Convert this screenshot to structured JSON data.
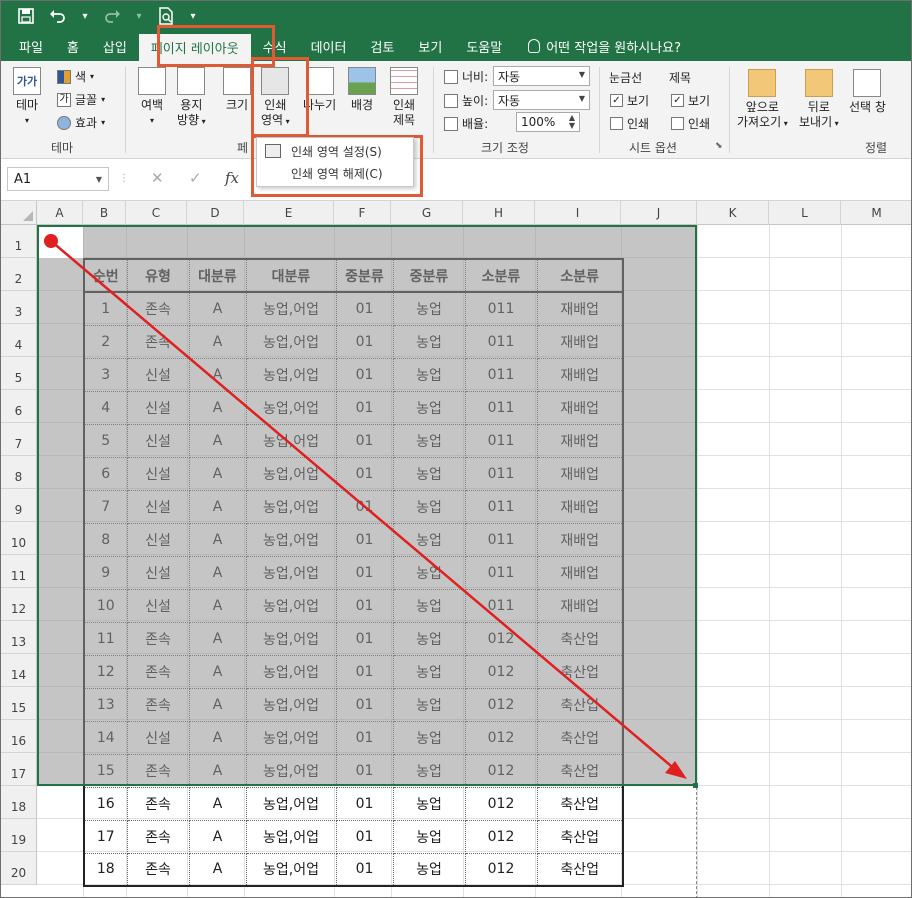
{
  "quick_access": {
    "save_icon": "save-icon",
    "undo_icon": "undo-icon",
    "redo_icon": "redo-icon",
    "print_preview_icon": "print-preview-icon",
    "customize_icon": "customize-arrow-icon"
  },
  "tabs": [
    {
      "label": "파일"
    },
    {
      "label": "홈"
    },
    {
      "label": "삽입"
    },
    {
      "label": "페이지 레이아웃",
      "active": true
    },
    {
      "label": "수식"
    },
    {
      "label": "데이터"
    },
    {
      "label": "검토"
    },
    {
      "label": "보기"
    },
    {
      "label": "도움말"
    }
  ],
  "tell_me": "어떤 작업을 원하시나요?",
  "ribbon": {
    "themes": {
      "label": "테마",
      "theme_button": "테마",
      "theme_icon_text": "가가",
      "colors": "색",
      "fonts": "글꼴",
      "effects": "효과",
      "fonts_icon_text": "가"
    },
    "page_setup": {
      "label_fragment": "페",
      "margins": "여백",
      "orientation_l1": "용지",
      "orientation_l2": "방향",
      "size": "크기",
      "print_area_l1": "인쇄",
      "print_area_l2": "영역",
      "breaks": "나누기",
      "background": "배경",
      "print_titles_l1": "인쇄",
      "print_titles_l2": "제목"
    },
    "scale": {
      "label": "크기 조정",
      "width_label": "너비:",
      "width_value": "자동",
      "height_label": "높이:",
      "height_value": "자동",
      "scale_label": "배율:",
      "scale_value": "100%"
    },
    "sheet_options": {
      "label": "시트 옵션",
      "gridlines": "눈금선",
      "headings": "제목",
      "view": "보기",
      "print": "인쇄"
    },
    "arrange": {
      "label": "정렬",
      "bring_forward_l1": "앞으로",
      "bring_forward_l2": "가져오기",
      "send_backward_l1": "뒤로",
      "send_backward_l2": "보내기",
      "selection_pane": "선택 창"
    }
  },
  "print_area_menu": {
    "set": "인쇄 영역 설정(S)",
    "clear": "인쇄 영역 해제(C)"
  },
  "formula_bar": {
    "name_box": "A1",
    "cancel": "✕",
    "enter": "✓",
    "fx": "fx"
  },
  "columns": [
    "A",
    "B",
    "C",
    "D",
    "E",
    "F",
    "G",
    "H",
    "I",
    "J",
    "K",
    "L",
    "M"
  ],
  "rows": [
    "1",
    "2",
    "3",
    "4",
    "5",
    "6",
    "7",
    "8",
    "9",
    "10",
    "11",
    "12",
    "13",
    "14",
    "15",
    "16",
    "17",
    "18",
    "19",
    "20"
  ],
  "table": {
    "headers": [
      "순번",
      "유형",
      "대분류",
      "대분류",
      "중분류",
      "중분류",
      "소분류",
      "소분류"
    ],
    "rows": [
      [
        "1",
        "존속",
        "A",
        "농업,어업",
        "01",
        "농업",
        "011",
        "재배업"
      ],
      [
        "2",
        "존속",
        "A",
        "농업,어업",
        "01",
        "농업",
        "011",
        "재배업"
      ],
      [
        "3",
        "신설",
        "A",
        "농업,어업",
        "01",
        "농업",
        "011",
        "재배업"
      ],
      [
        "4",
        "신설",
        "A",
        "농업,어업",
        "01",
        "농업",
        "011",
        "재배업"
      ],
      [
        "5",
        "신설",
        "A",
        "농업,어업",
        "01",
        "농업",
        "011",
        "재배업"
      ],
      [
        "6",
        "신설",
        "A",
        "농업,어업",
        "01",
        "농업",
        "011",
        "재배업"
      ],
      [
        "7",
        "신설",
        "A",
        "농업,어업",
        "01",
        "농업",
        "011",
        "재배업"
      ],
      [
        "8",
        "신설",
        "A",
        "농업,어업",
        "01",
        "농업",
        "011",
        "재배업"
      ],
      [
        "9",
        "신설",
        "A",
        "농업,어업",
        "01",
        "농업",
        "011",
        "재배업"
      ],
      [
        "10",
        "신설",
        "A",
        "농업,어업",
        "01",
        "농업",
        "011",
        "재배업"
      ],
      [
        "11",
        "존속",
        "A",
        "농업,어업",
        "01",
        "농업",
        "012",
        "축산업"
      ],
      [
        "12",
        "존속",
        "A",
        "농업,어업",
        "01",
        "농업",
        "012",
        "축산업"
      ],
      [
        "13",
        "존속",
        "A",
        "농업,어업",
        "01",
        "농업",
        "012",
        "축산업"
      ],
      [
        "14",
        "신설",
        "A",
        "농업,어업",
        "01",
        "농업",
        "012",
        "축산업"
      ],
      [
        "15",
        "존속",
        "A",
        "농업,어업",
        "01",
        "농업",
        "012",
        "축산업"
      ],
      [
        "16",
        "존속",
        "A",
        "농업,어업",
        "01",
        "농업",
        "012",
        "축산업"
      ],
      [
        "17",
        "존속",
        "A",
        "농업,어업",
        "01",
        "농업",
        "012",
        "축산업"
      ],
      [
        "18",
        "존속",
        "A",
        "농업,어업",
        "01",
        "농업",
        "012",
        "축산업"
      ]
    ]
  },
  "colors": {
    "excel_green": "#217346",
    "highlight": "#e05a33",
    "arrow": "#e02020"
  }
}
